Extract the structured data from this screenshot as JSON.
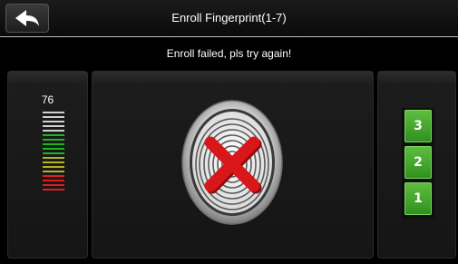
{
  "header": {
    "title": "Enroll Fingerprint(1-7)",
    "back_icon": "back-arrow-icon"
  },
  "status": {
    "message": "Enroll failed, pls try again!"
  },
  "quality": {
    "value": "76",
    "bar_colors": [
      "#cfcfcf",
      "#cfcfcf",
      "#cfcfcf",
      "#cfcfcf",
      "#cfcfcf",
      "#1db41d",
      "#1db41d",
      "#1db41d",
      "#1db41d",
      "#1db41d",
      "#b4b41d",
      "#b4b41d",
      "#b4b41d",
      "#b4b41d",
      "#e01d1d",
      "#e01d1d",
      "#e01d1d",
      "#e01d1d"
    ]
  },
  "scan": {
    "icon": "fingerprint-failed-icon",
    "result_color": "#d9161a"
  },
  "steps": {
    "items": [
      {
        "label": "3"
      },
      {
        "label": "2"
      },
      {
        "label": "1"
      }
    ],
    "accent": "#3c9d28"
  }
}
